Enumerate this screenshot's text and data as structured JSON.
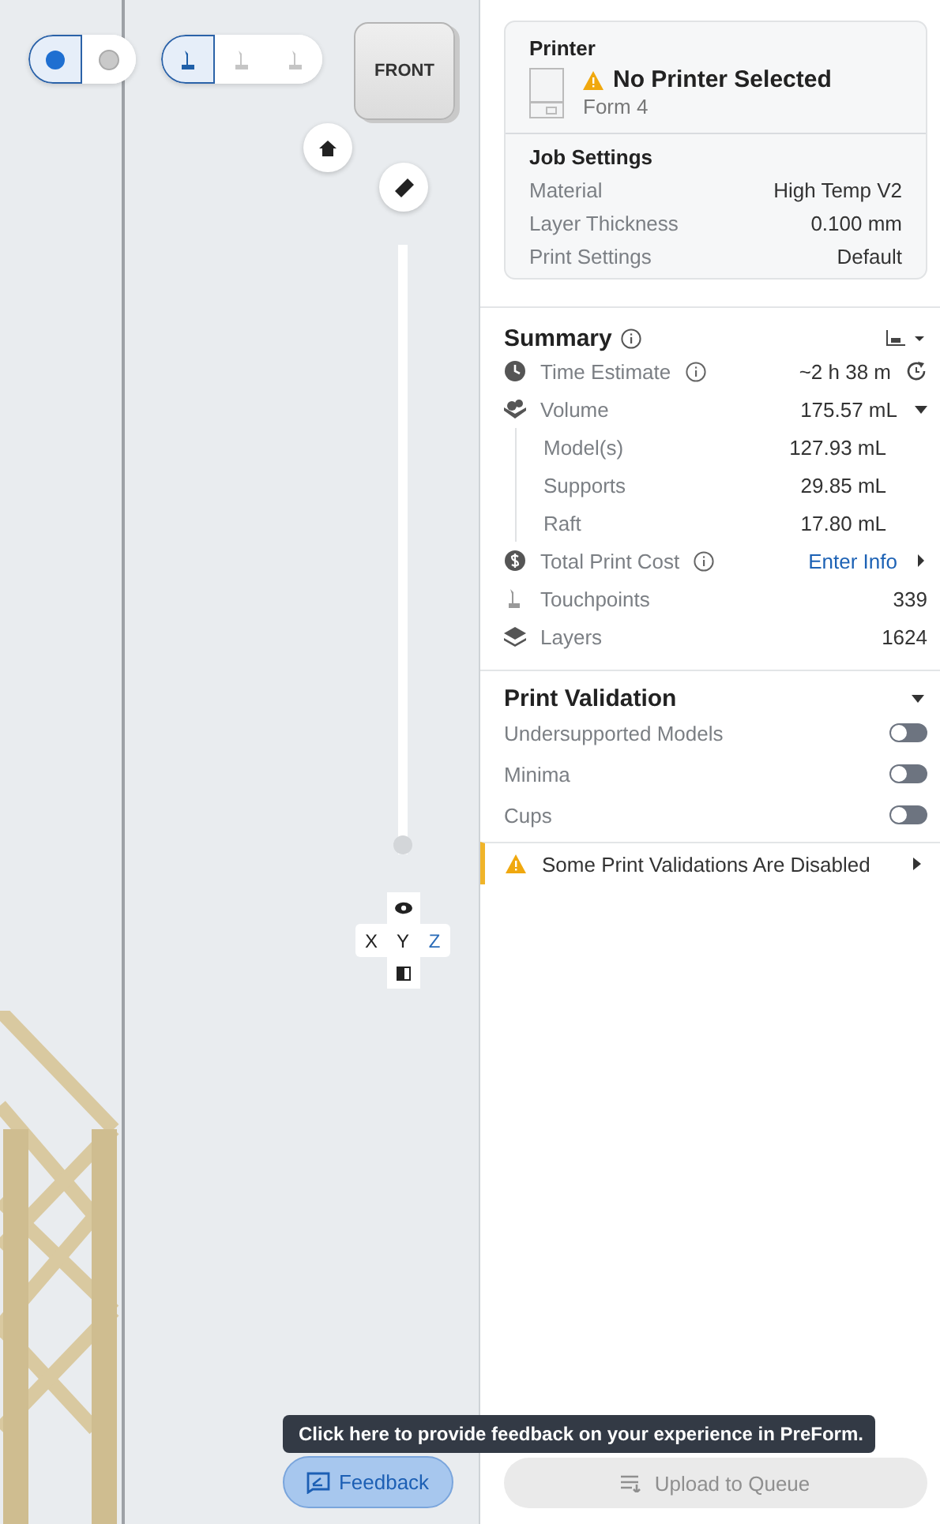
{
  "view_toggles": [
    {
      "kind": "solid",
      "selected": true
    },
    {
      "kind": "ghost",
      "selected": false
    }
  ],
  "support_toggles": [
    {
      "selected": true
    },
    {
      "selected": false
    },
    {
      "selected": false
    }
  ],
  "view_cube": {
    "face_label": "FRONT"
  },
  "layer_slider": {
    "level": 0
  },
  "axis_pad": {
    "axes": [
      {
        "label": "X",
        "selected": false
      },
      {
        "label": "Y",
        "selected": false
      },
      {
        "label": "Z",
        "selected": true
      }
    ]
  },
  "tooltip": "Click here to provide feedback on your experience in PreForm.",
  "feedback_button": "Feedback",
  "printer": {
    "title": "Printer",
    "status": "No Printer Selected",
    "model": "Form 4"
  },
  "job_settings": {
    "title": "Job Settings",
    "rows": [
      {
        "label": "Material",
        "value": "High Temp V2"
      },
      {
        "label": "Layer Thickness",
        "value": "0.100 mm"
      },
      {
        "label": "Print Settings",
        "value": "Default"
      }
    ]
  },
  "summary": {
    "title": "Summary",
    "rows": [
      {
        "kind": "time",
        "label": "Time Estimate",
        "info": true,
        "value": "~2 h 38 m",
        "link": false,
        "children": []
      },
      {
        "kind": "volume",
        "label": "Volume",
        "info": false,
        "value": "175.57 mL",
        "link": false,
        "expanded": true,
        "children": [
          {
            "label": "Model(s)",
            "value": "127.93 mL"
          },
          {
            "label": "Supports",
            "value": "29.85 mL"
          },
          {
            "label": "Raft",
            "value": "17.80 mL"
          }
        ]
      },
      {
        "kind": "cost",
        "label": "Total Print Cost",
        "info": true,
        "value": "Enter Info",
        "link": true,
        "children": []
      },
      {
        "kind": "touchpoints",
        "label": "Touchpoints",
        "info": false,
        "value": "339",
        "link": false,
        "children": []
      },
      {
        "kind": "layers",
        "label": "Layers",
        "info": false,
        "value": "1624",
        "link": false,
        "children": []
      }
    ]
  },
  "validation": {
    "title": "Print Validation",
    "items": [
      {
        "label": "Undersupported Models",
        "on": false
      },
      {
        "label": "Minima",
        "on": false
      },
      {
        "label": "Cups",
        "on": false
      }
    ],
    "warning": "Some Print Validations Are Disabled"
  },
  "upload_button": {
    "label": "Upload to Queue",
    "disabled": true
  }
}
